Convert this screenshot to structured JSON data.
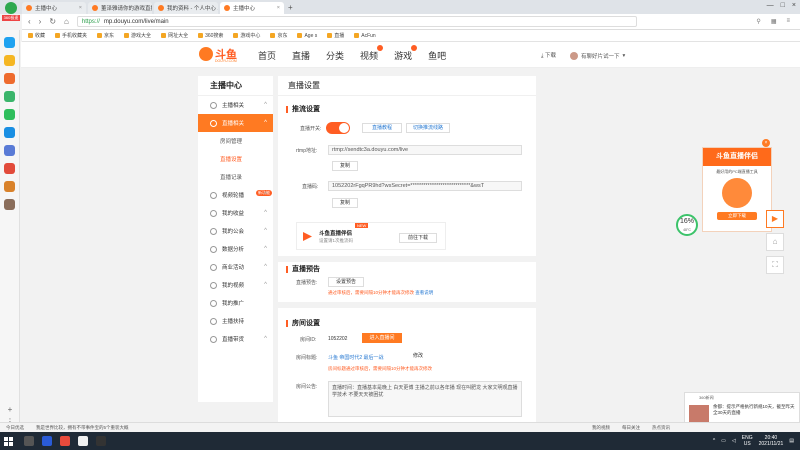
{
  "browser": {
    "app_badge": "360极速",
    "tabs": [
      {
        "title": "主播中心",
        "active": false,
        "color": "#ff7a22"
      },
      {
        "title": "董泽雅请你的游戏直播 ...",
        "active": false,
        "color": "#ff7a22"
      },
      {
        "title": "我的资料 - 个人中心 ...",
        "active": false,
        "color": "#ff7a22"
      },
      {
        "title": "主播中心",
        "active": true,
        "color": "#ff7a22"
      }
    ],
    "url_secure": "https://",
    "url": "mp.douyu.com/live/main",
    "bookmarks": [
      "收藏",
      "手机收藏夹",
      "京东",
      "游戏大全",
      "网址大全",
      "360搜索",
      "游戏中心",
      "京东",
      "Age s",
      "直播",
      "AcFun"
    ],
    "status_left": [
      "今日优选",
      "我是世界比较，拥有不带事件宝的5个重装大概"
    ],
    "status_right": [
      "我的视频",
      "每日关注",
      "热点资讯"
    ]
  },
  "site": {
    "brand": "斗鱼",
    "brand_sub": "DOUYU.COM",
    "nav": [
      "首页",
      "直播",
      "分类",
      "视频",
      "游戏",
      "鱼吧"
    ],
    "download": "下载",
    "user": "有聊好片试一下"
  },
  "menu": {
    "title": "主播中心",
    "items": [
      {
        "label": "主播相关",
        "caret": "^",
        "type": "group",
        "state": ""
      },
      {
        "label": "直播相关",
        "caret": "^",
        "type": "group",
        "state": "active"
      },
      {
        "label": "房间管理",
        "caret": "",
        "type": "sub",
        "state": ""
      },
      {
        "label": "直播设置",
        "caret": "",
        "type": "sub",
        "state": "cur"
      },
      {
        "label": "直播记录",
        "caret": "",
        "type": "sub",
        "state": ""
      },
      {
        "label": "视频轮播",
        "caret": "^",
        "type": "group",
        "state": "",
        "tag": "新功能"
      },
      {
        "label": "我的收益",
        "caret": "^",
        "type": "group",
        "state": ""
      },
      {
        "label": "我的公会",
        "caret": "^",
        "type": "group",
        "state": ""
      },
      {
        "label": "数据分析",
        "caret": "^",
        "type": "group",
        "state": ""
      },
      {
        "label": "商业活动",
        "caret": "^",
        "type": "group",
        "state": ""
      },
      {
        "label": "我的视频",
        "caret": "^",
        "type": "group",
        "state": ""
      },
      {
        "label": "我的推广",
        "caret": "",
        "type": "group",
        "state": ""
      },
      {
        "label": "主播扶持",
        "caret": "",
        "type": "group",
        "state": ""
      },
      {
        "label": "直播带货",
        "caret": "^",
        "type": "group",
        "state": ""
      }
    ]
  },
  "content": {
    "title": "直播设置",
    "push": {
      "section": "推流设置",
      "switch_label": "直播开关:",
      "tutorial_btn": "直播教程",
      "alt_btn": "切换推流线路",
      "rtmp_label": "rtmp地址:",
      "rtmp_value": "rtmp://sendtc3a.douyu.com/live",
      "copy_btn": "复制",
      "code_label": "直播码:",
      "code_value": "1052202rFgqPR9hd?wsSecret=****************************&wsT",
      "copy_btn2": "复制"
    },
    "companion": {
      "name": "斗鱼直播伴侣",
      "desc": "设置请1次推流码",
      "new_tag": "NEW",
      "download_btn": "前往下载"
    },
    "notice": {
      "section": "直播预告",
      "label": "直播预告:",
      "set_btn": "设置预告",
      "warn": "通过审核后，需要间隔10分钟才能再次修改",
      "link": "查看说明"
    },
    "room": {
      "section": "房间设置",
      "id_label": "房间ID:",
      "id_value": "1052202",
      "enter_btn": "进入直播间",
      "title_label": "房间标题:",
      "title_value": "斗鱼 帝国时代2 最后一战",
      "edit_btn": "修改",
      "title_warn": "房间标题通过审核后，需要间隔10分钟才能再次修改",
      "ann_label": "房间公告:",
      "ann_value": "直播时间：直播基本是晚上 白天更博 主播之前以各年播 现在叫肥龙 大家文明观直播学技术 不要天天被困扰"
    }
  },
  "promo": {
    "title": "斗鱼直播伴侣",
    "sub": "最好用的PC端直播工具",
    "download": "立即下载",
    "close": "×"
  },
  "gauge": {
    "percent": "16%",
    "temp": "48°C"
  },
  "notification": {
    "head": "360新闻",
    "text": "余都：提示严格执行新规10天，截至昨天全30天的直播"
  },
  "taskbar": {
    "lang": "ENG",
    "region": "US",
    "time": "20:40",
    "date": "2021/11/21"
  }
}
